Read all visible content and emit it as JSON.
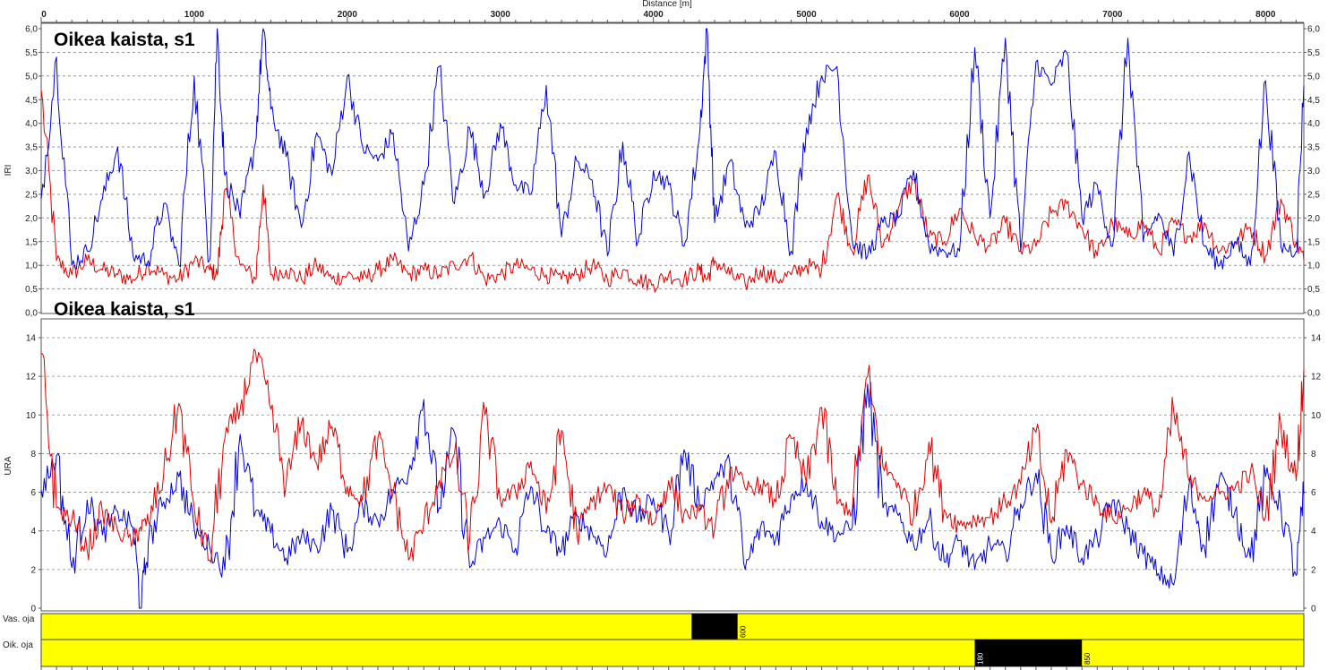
{
  "chart_data": [
    {
      "type": "line",
      "title": "Oikea kaista, s1",
      "xlabel": "Distance [m]",
      "ylabel": "IRI",
      "xlim": [
        0,
        8250
      ],
      "ylim": [
        0,
        6
      ],
      "x_ticks": [
        "0",
        "1000",
        "2000",
        "3000",
        "4000",
        "5000",
        "6000",
        "7000",
        "8000"
      ],
      "y_ticks": [
        "0,0",
        "0,5",
        "1,0",
        "1,5",
        "2,0",
        "2,5",
        "3,0",
        "3,5",
        "4,0",
        "4,5",
        "5,0",
        "5,5",
        "6,0"
      ],
      "grid": true,
      "series_colors": [
        "#0000e0",
        "#e00000"
      ],
      "series": [
        {
          "x": [
            0,
            100,
            200,
            300,
            400,
            500,
            600,
            700,
            800,
            900,
            1000,
            1100,
            1150,
            1200,
            1300,
            1400,
            1450,
            1500,
            1600,
            1700,
            1800,
            1900,
            2000,
            2100,
            2200,
            2300,
            2400,
            2500,
            2600,
            2700,
            2800,
            2900,
            3000,
            3100,
            3200,
            3300,
            3400,
            3500,
            3600,
            3700,
            3800,
            3900,
            4000,
            4100,
            4200,
            4300,
            4350,
            4400,
            4500,
            4600,
            4700,
            4800,
            4900,
            5000,
            5100,
            5200,
            5300,
            5400,
            5500,
            5600,
            5700,
            5800,
            5900,
            6000,
            6100,
            6200,
            6300,
            6400,
            6500,
            6600,
            6700,
            6800,
            6900,
            7000,
            7100,
            7200,
            7300,
            7400,
            7500,
            7600,
            7700,
            7800,
            7900,
            8000,
            8100,
            8200,
            8250
          ],
          "values": [
            2.4,
            5.4,
            1.0,
            1.3,
            2.4,
            3.5,
            1.2,
            1.1,
            2.3,
            1.0,
            5.0,
            1.1,
            6.0,
            2.9,
            2.0,
            3.6,
            6.0,
            4.3,
            3.3,
            1.8,
            3.8,
            2.9,
            5.0,
            3.5,
            3.2,
            3.8,
            1.3,
            2.7,
            5.2,
            2.3,
            3.9,
            2.5,
            4.0,
            2.7,
            2.5,
            4.8,
            1.6,
            3.2,
            2.8,
            1.2,
            3.6,
            1.5,
            3.0,
            2.7,
            1.4,
            3.7,
            6.0,
            1.9,
            3.2,
            1.8,
            2.2,
            3.4,
            1.3,
            3.9,
            5.0,
            5.2,
            1.5,
            1.2,
            1.9,
            2.0,
            3.0,
            1.4,
            1.3,
            1.3,
            5.6,
            2.0,
            5.8,
            1.3,
            5.3,
            4.8,
            5.5,
            2.0,
            2.7,
            1.4,
            5.8,
            1.5,
            2.1,
            1.2,
            3.4,
            1.4,
            1.0,
            1.5,
            1.0,
            4.9,
            1.4,
            1.3,
            4.8
          ]
        },
        {
          "x": [
            0,
            100,
            200,
            300,
            400,
            500,
            600,
            700,
            800,
            900,
            1000,
            1100,
            1150,
            1200,
            1300,
            1400,
            1450,
            1500,
            1600,
            1700,
            1800,
            1900,
            2000,
            2100,
            2200,
            2300,
            2400,
            2500,
            2600,
            2700,
            2800,
            2900,
            3000,
            3100,
            3200,
            3300,
            3400,
            3500,
            3600,
            3700,
            3800,
            3900,
            4000,
            4100,
            4200,
            4300,
            4350,
            4400,
            4500,
            4600,
            4700,
            4800,
            4900,
            5000,
            5100,
            5200,
            5300,
            5400,
            5500,
            5600,
            5700,
            5800,
            5900,
            6000,
            6100,
            6200,
            6300,
            6400,
            6500,
            6600,
            6700,
            6800,
            6900,
            7000,
            7100,
            7200,
            7300,
            7400,
            7500,
            7600,
            7700,
            7800,
            7900,
            8000,
            8100,
            8200,
            8250
          ],
          "values": [
            4.7,
            1.1,
            0.8,
            1.1,
            0.9,
            0.8,
            0.7,
            1.0,
            0.8,
            0.7,
            1.1,
            0.9,
            0.8,
            2.6,
            1.0,
            0.7,
            2.7,
            0.8,
            0.9,
            0.7,
            1.0,
            0.7,
            0.8,
            0.7,
            0.9,
            1.1,
            0.8,
            0.9,
            0.8,
            1.0,
            1.2,
            0.7,
            0.8,
            1.0,
            0.9,
            0.8,
            0.7,
            0.8,
            1.0,
            0.7,
            0.9,
            0.7,
            0.6,
            0.8,
            0.7,
            0.9,
            0.7,
            1.1,
            0.8,
            0.6,
            0.9,
            0.7,
            0.8,
            1.0,
            0.9,
            2.5,
            1.3,
            2.9,
            1.4,
            2.2,
            2.8,
            1.6,
            1.5,
            2.2,
            1.6,
            1.4,
            1.9,
            1.3,
            1.4,
            2.1,
            2.3,
            1.8,
            1.2,
            1.9,
            1.6,
            1.9,
            1.3,
            1.9,
            1.6,
            1.9,
            1.3,
            1.5,
            1.8,
            1.2,
            2.4,
            1.5,
            1.1
          ]
        }
      ]
    },
    {
      "type": "line",
      "title": "Oikea kaista, s1",
      "xlabel": "",
      "ylabel": "URA",
      "xlim": [
        0,
        8250
      ],
      "ylim": [
        0,
        15
      ],
      "y_ticks": [
        "0",
        "2",
        "4",
        "6",
        "8",
        "10",
        "12",
        "14"
      ],
      "grid": true,
      "series_colors": [
        "#0000e0",
        "#e00000"
      ],
      "series": [
        {
          "x": [
            0,
            100,
            200,
            300,
            400,
            500,
            600,
            650,
            700,
            800,
            900,
            1000,
            1100,
            1200,
            1300,
            1400,
            1500,
            1600,
            1700,
            1800,
            1900,
            2000,
            2100,
            2200,
            2300,
            2400,
            2500,
            2600,
            2700,
            2800,
            2900,
            3000,
            3100,
            3200,
            3300,
            3400,
            3500,
            3600,
            3700,
            3800,
            3900,
            4000,
            4100,
            4200,
            4300,
            4400,
            4500,
            4600,
            4700,
            4800,
            4900,
            5000,
            5100,
            5200,
            5300,
            5400,
            5500,
            5600,
            5700,
            5800,
            5900,
            6000,
            6100,
            6200,
            6300,
            6400,
            6500,
            6600,
            6700,
            6800,
            6900,
            7000,
            7100,
            7200,
            7300,
            7400,
            7500,
            7600,
            7700,
            7800,
            7900,
            8000,
            8100,
            8200,
            8250
          ],
          "values": [
            6.1,
            7.9,
            2.1,
            5.6,
            3.8,
            5.0,
            4.2,
            0.0,
            3.4,
            5.5,
            6.8,
            4.1,
            3.2,
            2.0,
            9.0,
            5.0,
            3.9,
            2.6,
            3.7,
            3.2,
            5.1,
            2.9,
            5.3,
            4.5,
            6.1,
            7.0,
            10.8,
            5.2,
            9.1,
            2.1,
            3.6,
            4.4,
            3.1,
            6.3,
            3.9,
            3.0,
            4.8,
            3.9,
            3.0,
            6.2,
            4.6,
            5.7,
            3.9,
            8.2,
            5.4,
            6.7,
            7.5,
            2.0,
            4.2,
            3.6,
            5.8,
            6.6,
            4.5,
            3.8,
            4.2,
            11.6,
            5.2,
            4.8,
            3.3,
            4.6,
            2.4,
            3.5,
            2.0,
            3.3,
            2.9,
            5.4,
            7.0,
            2.7,
            4.3,
            2.6,
            3.6,
            5.6,
            4.1,
            2.8,
            1.8,
            1.2,
            6.4,
            3.2,
            6.8,
            5.0,
            2.6,
            6.8,
            5.3,
            1.7,
            5.9
          ]
        },
        {
          "x": [
            0,
            100,
            200,
            300,
            400,
            500,
            600,
            650,
            700,
            800,
            900,
            1000,
            1100,
            1200,
            1300,
            1400,
            1500,
            1600,
            1700,
            1800,
            1900,
            2000,
            2100,
            2200,
            2300,
            2400,
            2500,
            2600,
            2700,
            2800,
            2900,
            3000,
            3100,
            3200,
            3300,
            3400,
            3500,
            3600,
            3700,
            3800,
            3900,
            4000,
            4100,
            4200,
            4300,
            4400,
            4500,
            4600,
            4700,
            4800,
            4900,
            5000,
            5100,
            5200,
            5300,
            5400,
            5500,
            5600,
            5700,
            5800,
            5900,
            6000,
            6100,
            6200,
            6300,
            6400,
            6500,
            6600,
            6700,
            6800,
            6900,
            7000,
            7100,
            7200,
            7300,
            7400,
            7500,
            7600,
            7700,
            7800,
            7900,
            8000,
            8100,
            8200,
            8250
          ],
          "values": [
            13.2,
            5.2,
            4.6,
            3.0,
            5.0,
            4.0,
            3.5,
            4.2,
            4.5,
            6.9,
            10.6,
            5.2,
            2.5,
            8.8,
            10.3,
            13.3,
            10.3,
            6.4,
            9.6,
            7.5,
            9.4,
            6.3,
            5.6,
            8.8,
            6.0,
            2.5,
            4.4,
            6.6,
            8.0,
            3.5,
            10.0,
            5.6,
            6.0,
            7.6,
            4.9,
            9.2,
            3.8,
            5.5,
            6.3,
            4.8,
            5.7,
            4.4,
            6.6,
            4.9,
            5.0,
            4.1,
            7.2,
            6.2,
            6.4,
            5.5,
            8.8,
            6.5,
            10.4,
            5.4,
            5.1,
            12.0,
            7.3,
            6.5,
            4.7,
            8.6,
            5.1,
            4.3,
            4.6,
            4.7,
            5.5,
            6.4,
            9.1,
            4.4,
            8.2,
            6.4,
            5.5,
            4.6,
            5.2,
            6.0,
            5.0,
            10.2,
            6.6,
            5.8,
            5.9,
            6.2,
            7.0,
            4.7,
            9.5,
            6.6,
            12.4
          ]
        }
      ]
    }
  ],
  "bands": {
    "rows": [
      {
        "label": "Vas. oja",
        "color": "#ffff00",
        "segments": [
          {
            "start": 4250,
            "end": 4550,
            "color": "#000000",
            "start_label": "",
            "end_label": "600"
          }
        ]
      },
      {
        "label": "Oik. oja",
        "color": "#ffff00",
        "segments": [
          {
            "start": 6100,
            "end": 6800,
            "color": "#000000",
            "start_label": "180",
            "end_label": "850"
          }
        ]
      }
    ]
  }
}
